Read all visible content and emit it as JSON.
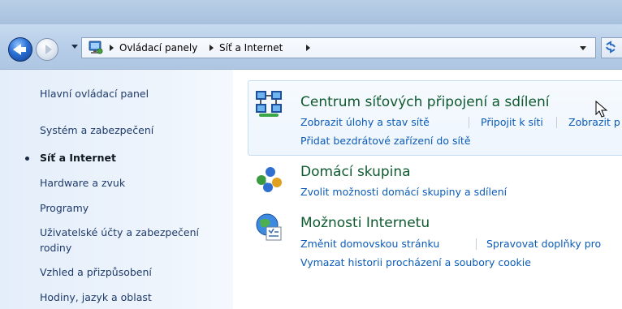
{
  "breadcrumb": [
    "Ovládací panely",
    "Síť a Internet"
  ],
  "sidebar": {
    "items": [
      {
        "label": "Hlavní ovládací panel"
      },
      {
        "label": "Systém a zabezpečení"
      },
      {
        "label": "Síť a Internet",
        "current": true
      },
      {
        "label": "Hardware a zvuk"
      },
      {
        "label": "Programy"
      },
      {
        "label": "Uživatelské účty a zabezpečení",
        "label_line2": "rodiny"
      },
      {
        "label": "Vzhled a přizpůsobení"
      },
      {
        "label": "Hodiny, jazyk a oblast"
      }
    ]
  },
  "categories": [
    {
      "title": "Centrum síťových připojení a sdílení",
      "icon": "network-center-icon",
      "links": [
        "Zobrazit úlohy a stav sítě",
        "Připojit k síti",
        "Zobrazit p"
      ],
      "links_line2": [
        "Přidat bezdrátové zařízení do sítě"
      ]
    },
    {
      "title": "Domácí skupina",
      "icon": "homegroup-icon",
      "links": [
        "Zvolit možnosti domácí skupiny a sdílení"
      ]
    },
    {
      "title": "Možnosti Internetu",
      "icon": "internet-options-icon",
      "links": [
        "Změnit domovskou stránku",
        "Spravovat doplňky pro"
      ],
      "links_line2": [
        "Vymazat historii procházení a soubory cookie"
      ]
    }
  ],
  "colors": {
    "category_title": "#0e5a2e",
    "link": "#0b5bb8",
    "sidebar_link": "#1f3b6a",
    "chrome": "#b6cde8"
  }
}
